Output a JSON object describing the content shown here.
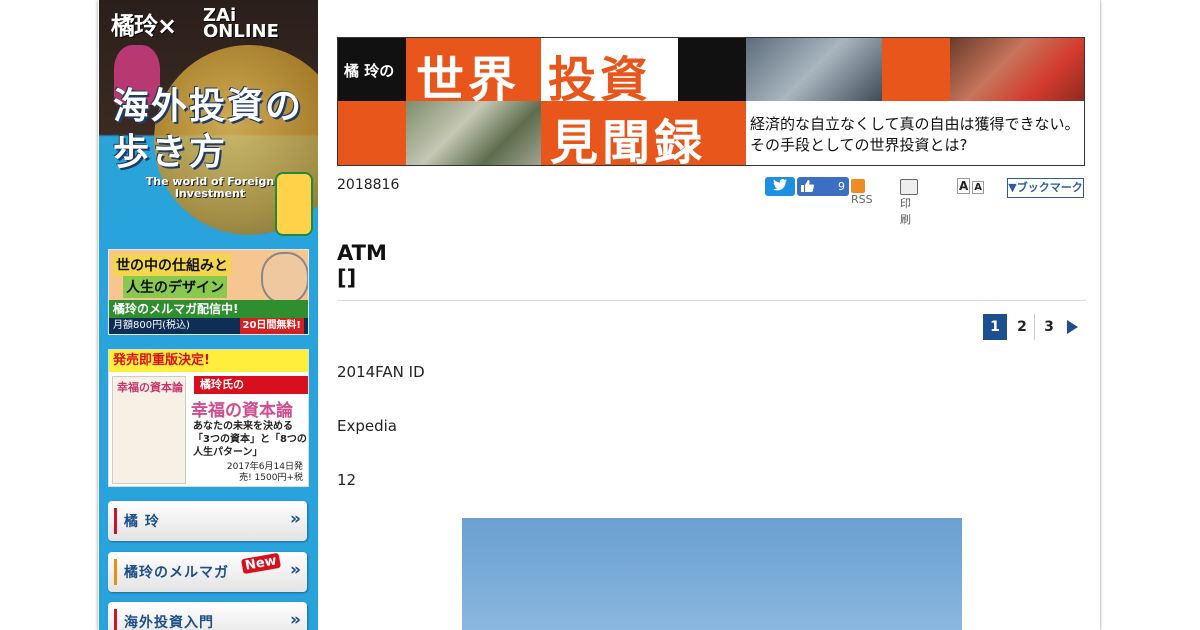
{
  "sidebar": {
    "logo": {
      "brand": "橘玲×",
      "zai": "ZAi ONLINE",
      "title": "海外投資の歩き方",
      "subtitle": "The world of Foreign Investment"
    },
    "banner_mailmag": {
      "line1": "世の中の仕組みと",
      "line2": "人生のデザイン",
      "line3": "橘玲のメルマガ配信中!",
      "price": "月額800円(税込)",
      "free": "20日間無料!"
    },
    "banner_book": {
      "head": "発売即重版決定!",
      "book_title": "幸福の資本論",
      "tag": "橘玲氏の",
      "title": "幸福の資本論",
      "desc": "あなたの未来を決める「3つの資本」と「8つの人生パターン」",
      "date": "2017年6月14日発売! 1500円+税"
    },
    "nav": [
      {
        "label": "橘 玲"
      },
      {
        "label": "橘玲のメルマガ",
        "badge": "New"
      },
      {
        "label": "海外投資入門"
      }
    ],
    "nav_arrow": "»"
  },
  "hero": {
    "brand": "橘 玲の",
    "title1": "世界",
    "title2": "投資",
    "title3": "見聞録",
    "tagline1": "経済的な自立なくして真の自由は獲得できない。",
    "tagline2": "その手段としての世界投資とは?"
  },
  "meta": {
    "date": "2018816",
    "like_count": "9",
    "rss": "RSS",
    "print": "印刷",
    "font_large": "A",
    "font_small": "A",
    "bookmark": "▼ブックマーク"
  },
  "article": {
    "title_line1": "ATM",
    "title_line2": "[]",
    "pages": [
      "1",
      "2",
      "3"
    ],
    "current_page": "1",
    "paragraphs": [
      "2014FAN ID",
      "Expedia",
      "12"
    ]
  },
  "colors": {
    "sidebar_bg": "#29a3dc",
    "hero_orange": "#e8561c",
    "accent_navy": "#1b4f8d"
  }
}
